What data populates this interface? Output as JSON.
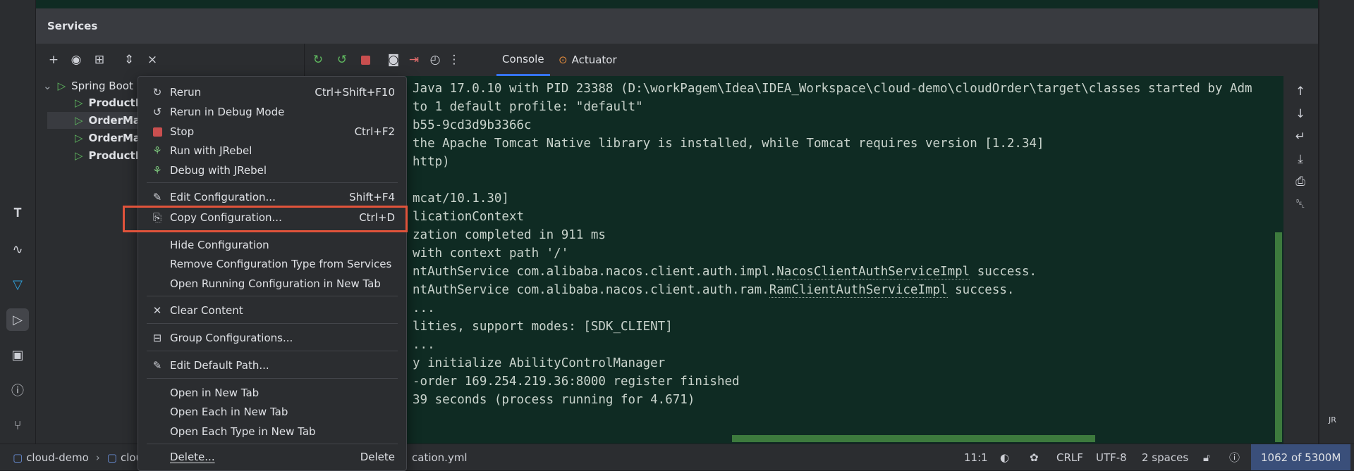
{
  "panel": {
    "title": "Services"
  },
  "tree_toolbar": {
    "icons": [
      "add-icon",
      "eye-icon",
      "new-group-icon",
      "expand-all-icon",
      "collapse-all-icon"
    ]
  },
  "console_toolbar": {
    "icons": [
      "rerun-icon",
      "rerun-debug-icon",
      "stop-icon",
      "screenshot-icon",
      "exit-icon",
      "dashboard-icon",
      "more-icon"
    ]
  },
  "tabs": [
    {
      "label": "Console",
      "active": true
    },
    {
      "label": "Actuator",
      "active": false
    }
  ],
  "tree": {
    "root": "Spring Boot",
    "items": [
      {
        "label": "ProductM",
        "selected": false
      },
      {
        "label": "OrderMa",
        "selected": true
      },
      {
        "label": "OrderMa",
        "selected": false
      },
      {
        "label": "ProductM",
        "selected": false
      }
    ]
  },
  "console": {
    "lines": [
      {
        "t": "Java 17.0.10 with PID 23388 (D:\\workPagem\\Idea\\IDEA_Workspace\\cloud-demo\\cloudOrder\\target\\classes started by Adm"
      },
      {
        "t": "to 1 default profile: \"default\""
      },
      {
        "t": "b55-9cd3d9b3366c"
      },
      {
        "t": "the Apache Tomcat Native library is installed, while Tomcat requires version [1.2.34]"
      },
      {
        "t": "http)"
      },
      {
        "t": ""
      },
      {
        "t": "mcat/10.1.30]"
      },
      {
        "t": "licationContext"
      },
      {
        "t": "zation completed in 911 ms"
      },
      {
        "t": "with context path '/'"
      },
      {
        "t": "ntAuthService com.alibaba.nacos.client.auth.impl.",
        "u": "NacosClientAuthServiceImpl",
        "t2": " success."
      },
      {
        "t": "ntAuthService com.alibaba.nacos.client.auth.ram.",
        "u": "RamClientAuthServiceImpl",
        "t2": " success."
      },
      {
        "t": "..."
      },
      {
        "t": "lities, support modes: [SDK_CLIENT]"
      },
      {
        "t": "..."
      },
      {
        "t": "y initialize AbilityControlManager"
      },
      {
        "t": "-order 169.254.219.36:8000 register finished"
      },
      {
        "t": "39 seconds (process running for 4.671)"
      }
    ]
  },
  "menu": {
    "items": [
      {
        "label": "Rerun",
        "shortcut": "Ctrl+Shift+F10",
        "icon": "rerun-icon"
      },
      {
        "label": "Rerun in Debug Mode",
        "shortcut": "",
        "icon": "rerun-debug-icon"
      },
      {
        "label": "Stop",
        "shortcut": "Ctrl+F2",
        "icon": "stop-icon"
      },
      {
        "label": "Run with JRebel",
        "shortcut": "",
        "icon": "jrebel-run-icon"
      },
      {
        "label": "Debug with JRebel",
        "shortcut": "",
        "icon": "jrebel-debug-icon"
      },
      {
        "label": "Edit Configuration...",
        "shortcut": "Shift+F4",
        "icon": "pencil-icon"
      },
      {
        "label": "Copy Configuration...",
        "shortcut": "Ctrl+D",
        "icon": "copy-icon",
        "highlighted": true
      },
      {
        "label": "Hide Configuration",
        "shortcut": "",
        "icon": ""
      },
      {
        "label": "Remove Configuration Type from Services",
        "shortcut": "",
        "icon": ""
      },
      {
        "label": "Open Running Configuration in New Tab",
        "shortcut": "",
        "icon": ""
      },
      {
        "label": "Clear Content",
        "shortcut": "",
        "icon": "close-icon"
      },
      {
        "label": "Group Configurations...",
        "shortcut": "",
        "icon": "group-icon"
      },
      {
        "label": "Edit Default Path...",
        "shortcut": "",
        "icon": "pencil-icon"
      },
      {
        "label": "Open in New Tab",
        "shortcut": "",
        "icon": ""
      },
      {
        "label": "Open Each in New Tab",
        "shortcut": "",
        "icon": ""
      },
      {
        "label": "Open Each Type in New Tab",
        "shortcut": "",
        "icon": ""
      },
      {
        "label": "Delete...",
        "shortcut": "Delete",
        "icon": ""
      }
    ]
  },
  "status_bar": {
    "project": "cloud-demo",
    "crumb2": "clou",
    "file": "cation.yml",
    "position": "11:1",
    "line_ending": "CRLF",
    "encoding": "UTF-8",
    "indent": "2 spaces",
    "memory": "1062 of 5300M"
  },
  "colors": {
    "highlight_box": "#e0533b",
    "console_bg": "#0f2b23",
    "run_green": "#5fb85f"
  }
}
